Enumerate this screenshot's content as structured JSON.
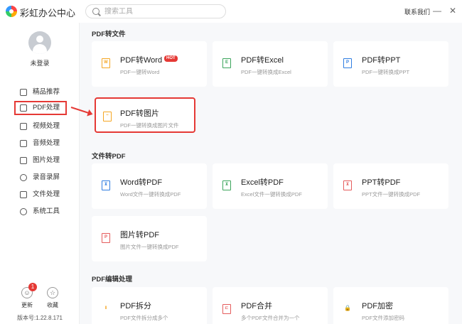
{
  "app": {
    "title": "彩虹办公中心",
    "contact": "联系我们"
  },
  "search": {
    "placeholder": "搜索工具"
  },
  "window": {
    "minimize": "—",
    "close": "✕"
  },
  "user": {
    "status": "未登录"
  },
  "sidebar": {
    "items": [
      {
        "label": "精品推荐",
        "icon": "thumbs-up-icon"
      },
      {
        "label": "PDF处理",
        "icon": "pdf-icon",
        "active": true
      },
      {
        "label": "视频处理",
        "icon": "video-icon"
      },
      {
        "label": "音频处理",
        "icon": "music-icon"
      },
      {
        "label": "图片处理",
        "icon": "image-icon"
      },
      {
        "label": "录音录屏",
        "icon": "record-icon"
      },
      {
        "label": "文件处理",
        "icon": "folder-icon"
      },
      {
        "label": "系统工具",
        "icon": "gear-icon"
      }
    ],
    "update": {
      "label": "更新",
      "badge": "1"
    },
    "favorite": {
      "label": "收藏"
    },
    "version": "版本号:1.22.8.171"
  },
  "sections": [
    {
      "title": "PDF转文件",
      "cards": [
        {
          "title": "PDF转Word",
          "desc": "PDF一键转Word",
          "badge": "HOT",
          "icon_letter": "W",
          "color": "#f5a623"
        },
        {
          "title": "PDF转Excel",
          "desc": "PDF一键转换成Excel",
          "icon_letter": "E",
          "color": "#3ca55c"
        },
        {
          "title": "PDF转PPT",
          "desc": "PDF一键转换成PPT",
          "icon_letter": "P",
          "color": "#2f7de1"
        },
        {
          "title": "PDF转图片",
          "desc": "PDF一键转换成图片文件",
          "icon_letter": "~",
          "color": "#f5a623"
        }
      ]
    },
    {
      "title": "文件转PDF",
      "cards": [
        {
          "title": "Word转PDF",
          "desc": "Word文件一键转换成PDF",
          "icon_letter": "⊼",
          "color": "#2f7de1"
        },
        {
          "title": "Excel转PDF",
          "desc": "Excel文件一键转换成PDF",
          "icon_letter": "⊼",
          "color": "#3ca55c"
        },
        {
          "title": "PPT转PDF",
          "desc": "PPT文件一键转换成PDF",
          "icon_letter": "⊼",
          "color": "#e55c5c"
        },
        {
          "title": "图片转PDF",
          "desc": "图片文件一键转换成PDF",
          "icon_letter": "P",
          "color": "#e55c5c"
        }
      ]
    },
    {
      "title": "PDF编辑处理",
      "cards": [
        {
          "title": "PDF拆分",
          "desc": "PDF文件拆分成多个",
          "icon_letter": "‖",
          "color": "#f5a623"
        },
        {
          "title": "PDF合并",
          "desc": "多个PDF文件合并为一个",
          "icon_letter": "⊏",
          "color": "#e55c5c"
        },
        {
          "title": "PDF加密",
          "desc": "PDF文件添加密码",
          "icon_letter": "🔒",
          "color": "#f5a623"
        }
      ]
    }
  ]
}
